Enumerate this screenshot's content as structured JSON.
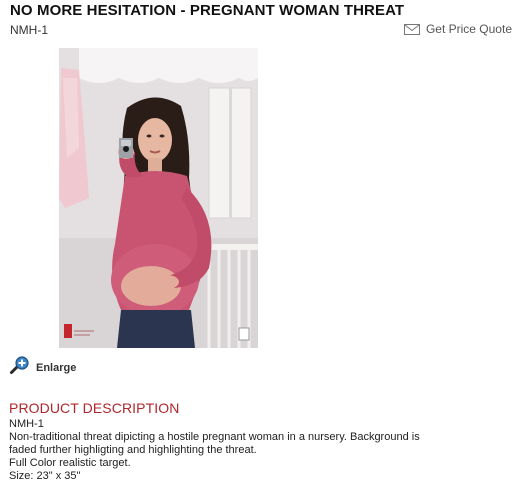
{
  "product": {
    "title": "NO MORE HESITATION - PREGNANT WOMAN THREAT",
    "sku": "NMH-1",
    "quote_label": "Get Price Quote",
    "image_alt": "Pregnant woman pointing a handgun in a nursery",
    "enlarge_label": "Enlarge"
  },
  "description": {
    "heading": "PRODUCT DESCRIPTION",
    "sku": "NMH-1",
    "lines": [
      "Non-traditional threat dipicting a hostile pregnant woman in a nursery. Background is",
      "faded further highligting and highlighting the threat.",
      "Full Color realistic target.",
      "Size: 23\" x 35\""
    ]
  },
  "icons": {
    "quote": "envelope-icon",
    "enlarge": "zoom-in-icon"
  },
  "colors": {
    "heading_red": "#b0262c",
    "shirt": "#c85471",
    "jeans": "#2b3550"
  }
}
